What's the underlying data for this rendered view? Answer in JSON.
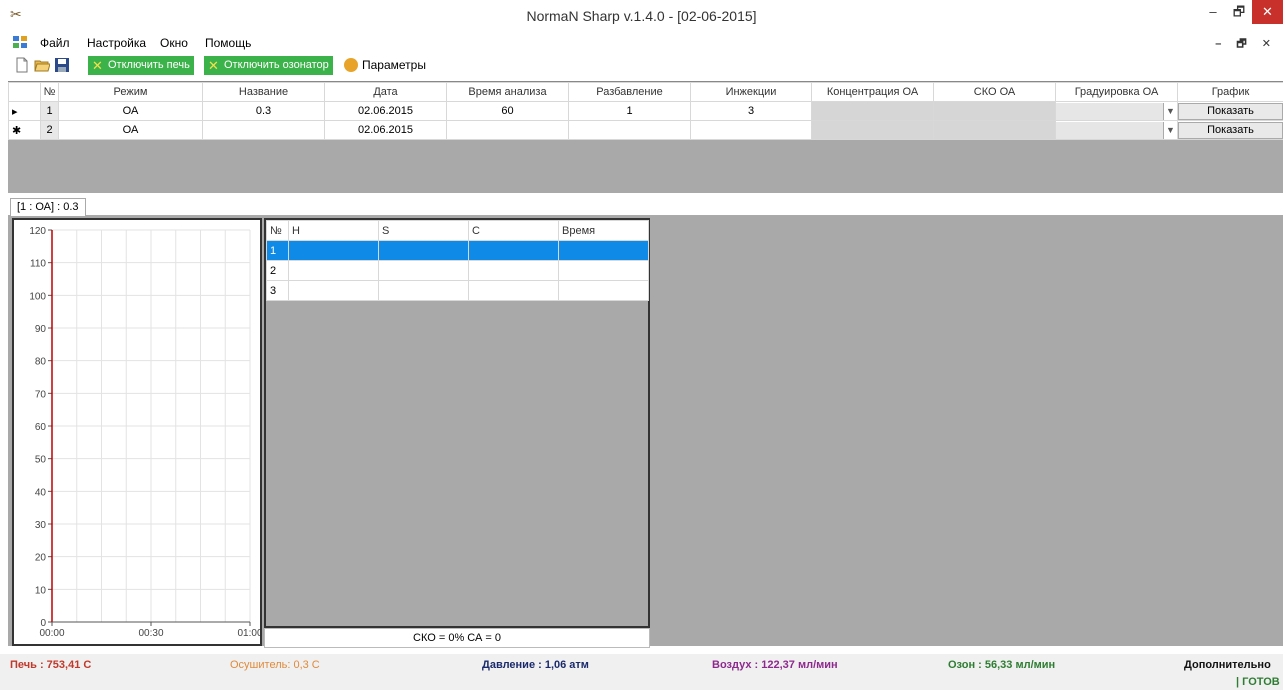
{
  "window": {
    "title": "NormaN Sharp v.1.4.0 - [02-06-2015]",
    "min": "–",
    "max": "🗗",
    "close": "✕"
  },
  "menu": {
    "items": [
      "Файл",
      "Настройка",
      "Окно",
      "Помощь"
    ],
    "mdi_controls": "– 🗗 ✕"
  },
  "toolbar": {
    "oven_label": "Отключить печь",
    "ozonator_label": "Отключить озонатор",
    "params_label": "Параметры"
  },
  "topgrid": {
    "columns": [
      "№",
      "Режим",
      "Название",
      "Дата",
      "Время анализа",
      "Разбавление",
      "Инжекции",
      "Концентрация ОА",
      "СКО ОА",
      "Градуировка ОА",
      "График"
    ],
    "rows": [
      {
        "marker": "▸",
        "num": "1",
        "mode": "ОА",
        "name": "0.3",
        "date": "02.06.2015",
        "time": "60",
        "dilution": "1",
        "injections": "3",
        "conc": "",
        "sko": "",
        "calib": "",
        "chart_btn": "Показать"
      },
      {
        "marker": "✱",
        "num": "2",
        "mode": "ОА",
        "name": "",
        "date": "02.06.2015",
        "time": "",
        "dilution": "",
        "injections": "",
        "conc": "",
        "sko": "",
        "calib": "",
        "chart_btn": "Показать"
      }
    ]
  },
  "tab": {
    "label": "[1 : ОА] : 0.3"
  },
  "innergrid": {
    "columns": [
      "№",
      "H",
      "S",
      "C",
      "Время"
    ],
    "rows": [
      {
        "num": "1",
        "h": "",
        "s": "",
        "c": "",
        "t": ""
      },
      {
        "num": "2",
        "h": "",
        "s": "",
        "c": "",
        "t": ""
      },
      {
        "num": "3",
        "h": "",
        "s": "",
        "c": "",
        "t": ""
      }
    ],
    "footer": "СКО = 0% СА = 0"
  },
  "chart_data": {
    "type": "line",
    "series": [],
    "x_ticks": [
      "00:00",
      "00:30",
      "01:00"
    ],
    "y_ticks": [
      "0",
      "10",
      "20",
      "30",
      "40",
      "50",
      "60",
      "70",
      "80",
      "90",
      "100",
      "110",
      "120"
    ],
    "ylim": [
      0,
      120
    ],
    "grid": true,
    "axis_color": "#c00000"
  },
  "status": {
    "oven": "Печь : 753,41 С",
    "dryer": "Осушитель: 0,3 С",
    "pressure": "Давление : 1,06 атм",
    "air": "Воздух : 122,37 мл/мин",
    "ozone": "Озон : 56,33 мл/мин",
    "extra": "Дополнительно",
    "ready": "| ГОТОВ"
  },
  "colors": {
    "oven": "#c0392b",
    "dryer": "#e08a3a",
    "pressure": "#1a2a6c",
    "air": "#8e2a8e",
    "ozone": "#2e7d32",
    "ready": "#2e7d32",
    "toolbar_green": "#3cb34a",
    "selection": "#0f8ae6"
  }
}
